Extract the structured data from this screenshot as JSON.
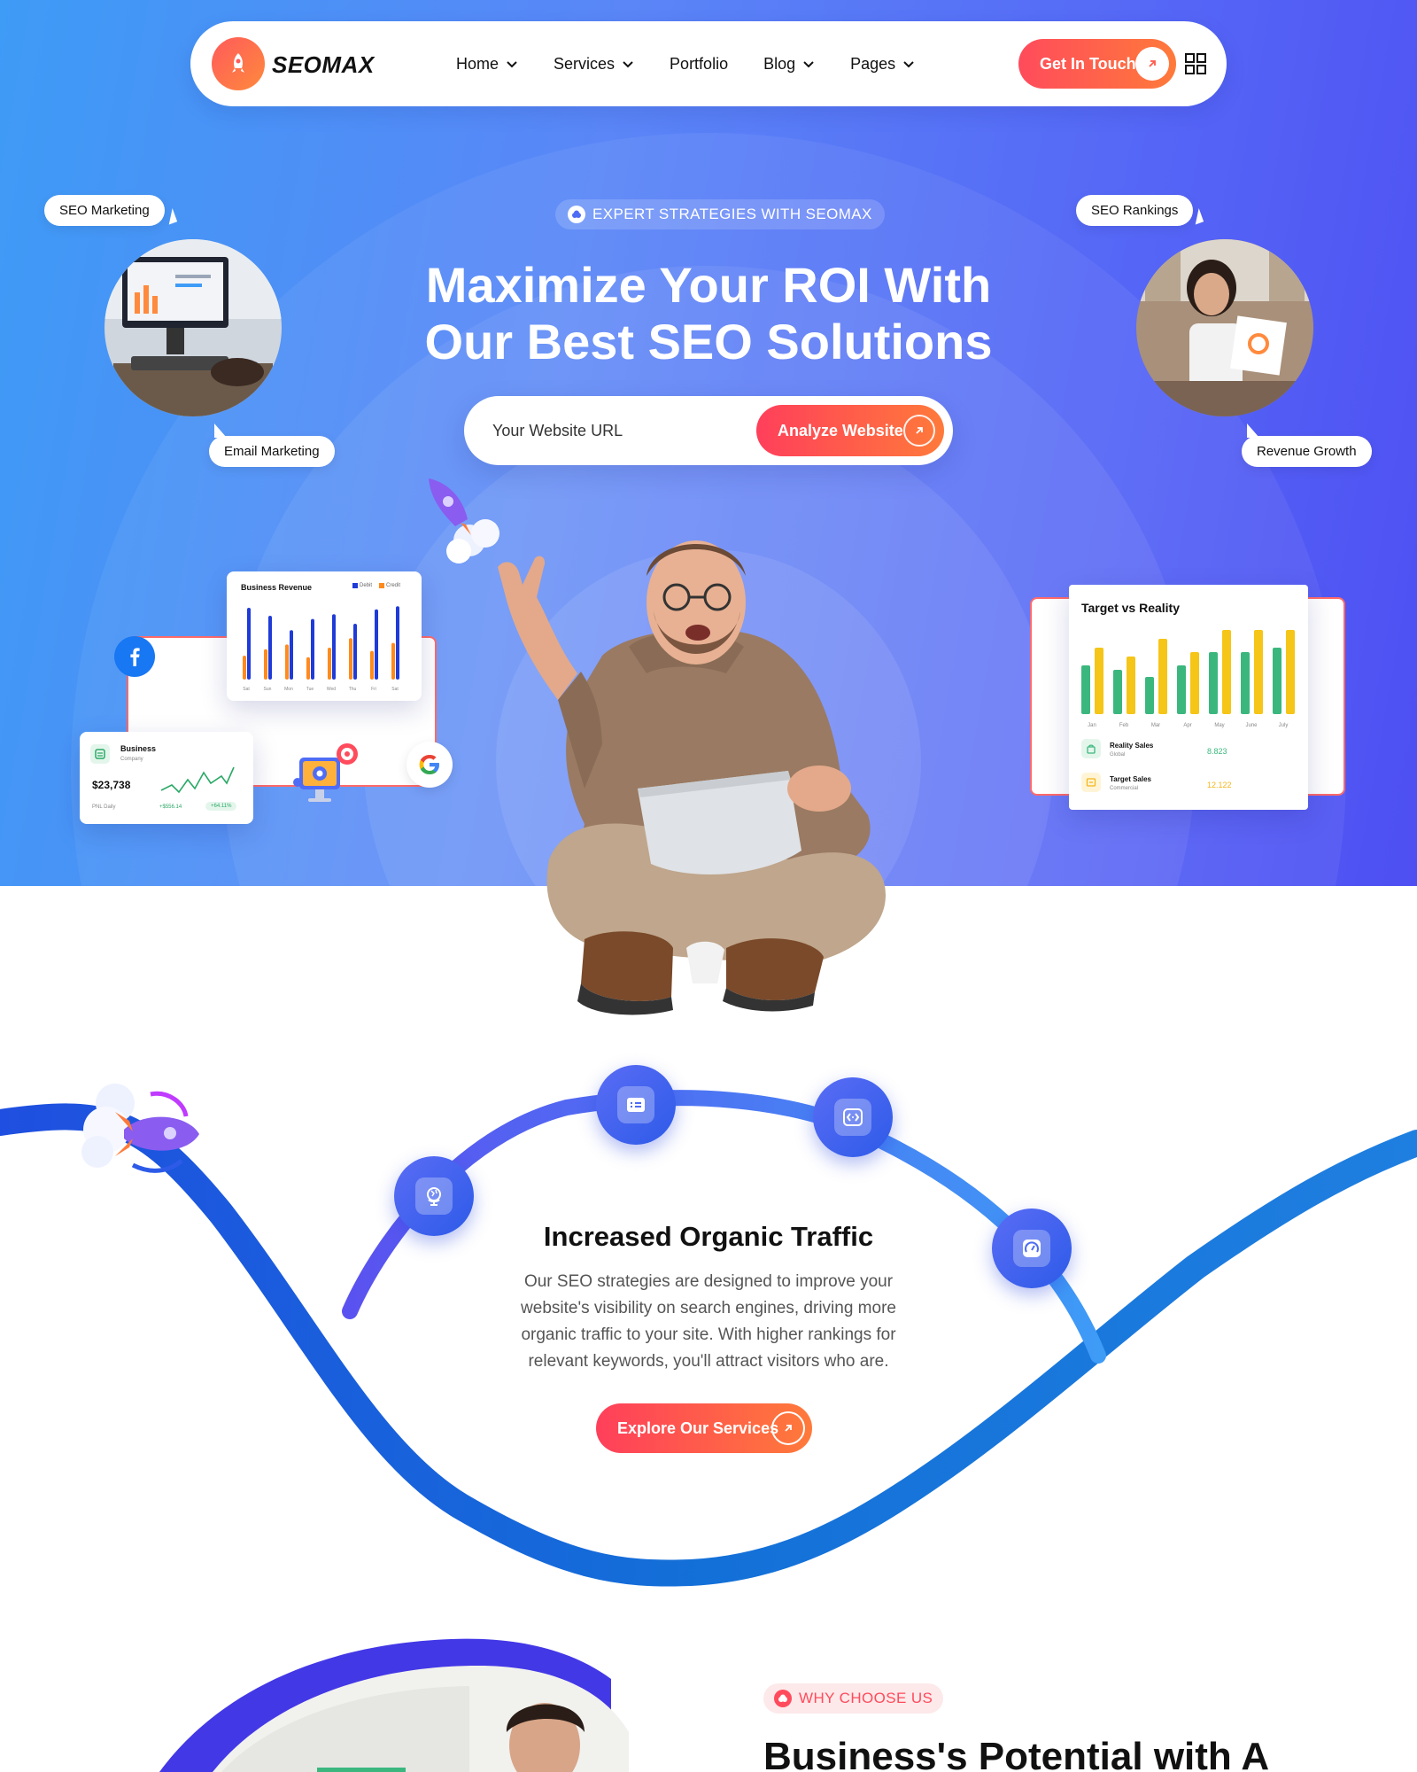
{
  "nav": {
    "logo": "SEOMAX",
    "menu": [
      {
        "label": "Home",
        "has_dropdown": true
      },
      {
        "label": "Services",
        "has_dropdown": true
      },
      {
        "label": "Portfolio",
        "has_dropdown": false
      },
      {
        "label": "Blog",
        "has_dropdown": true
      },
      {
        "label": "Pages",
        "has_dropdown": true
      }
    ],
    "cta_label": "Get In Touch"
  },
  "hero": {
    "eyebrow": "EXPERT STRATEGIES WITH SEOMAX",
    "title_line1": "Maximize Your ROI With",
    "title_line2": "Our Best SEO Solutions",
    "search_placeholder": "Your Website URL",
    "analyze_label": "Analyze Website",
    "bubbles": {
      "seo_marketing": "SEO Marketing",
      "email_marketing": "Email Marketing",
      "seo_rankings": "SEO Rankings",
      "revenue_growth": "Revenue Growth"
    }
  },
  "revenue_card": {
    "title": "Business Revenue",
    "legend": [
      "Debit",
      "Credit"
    ],
    "days": [
      "Sat",
      "Sun",
      "Mon",
      "Tue",
      "Wed",
      "Thu",
      "Fri",
      "Sat"
    ],
    "debit": [
      90,
      80,
      62,
      76,
      82,
      70,
      88,
      92
    ],
    "credit": [
      30,
      38,
      44,
      28,
      40,
      52,
      36,
      46
    ]
  },
  "business_card": {
    "title": "Business",
    "subtitle": "Company",
    "amount": "$23,738",
    "label": "PNL Daily",
    "change": "+$556.14",
    "badge": "+64.11%"
  },
  "target_card": {
    "title": "Target vs Reality",
    "months": [
      "Jan",
      "Feb",
      "Mar",
      "Apr",
      "May",
      "June",
      "July"
    ],
    "reality": [
      55,
      50,
      42,
      55,
      70,
      70,
      75
    ],
    "target": [
      75,
      65,
      85,
      70,
      95,
      95,
      95
    ],
    "rows": [
      {
        "label": "Reality Sales",
        "sub": "Global",
        "value": "8.823"
      },
      {
        "label": "Target Sales",
        "sub": "Commercial",
        "value": "12.122"
      }
    ],
    "colors": {
      "reality": "#3bb77e",
      "target": "#f5c518"
    }
  },
  "feature": {
    "title": "Increased Organic Traffic",
    "description": "Our SEO strategies are designed to improve your website's visibility on search engines, driving more organic traffic to your site. With higher rankings for relevant keywords, you'll attract visitors who are.",
    "cta_label": "Explore Our Services"
  },
  "why": {
    "tag": "WHY CHOOSE US",
    "title": "Business's Potential with A"
  },
  "colors": {
    "accent": "#ff4b5c",
    "brand_blue": "#2d5be8"
  }
}
